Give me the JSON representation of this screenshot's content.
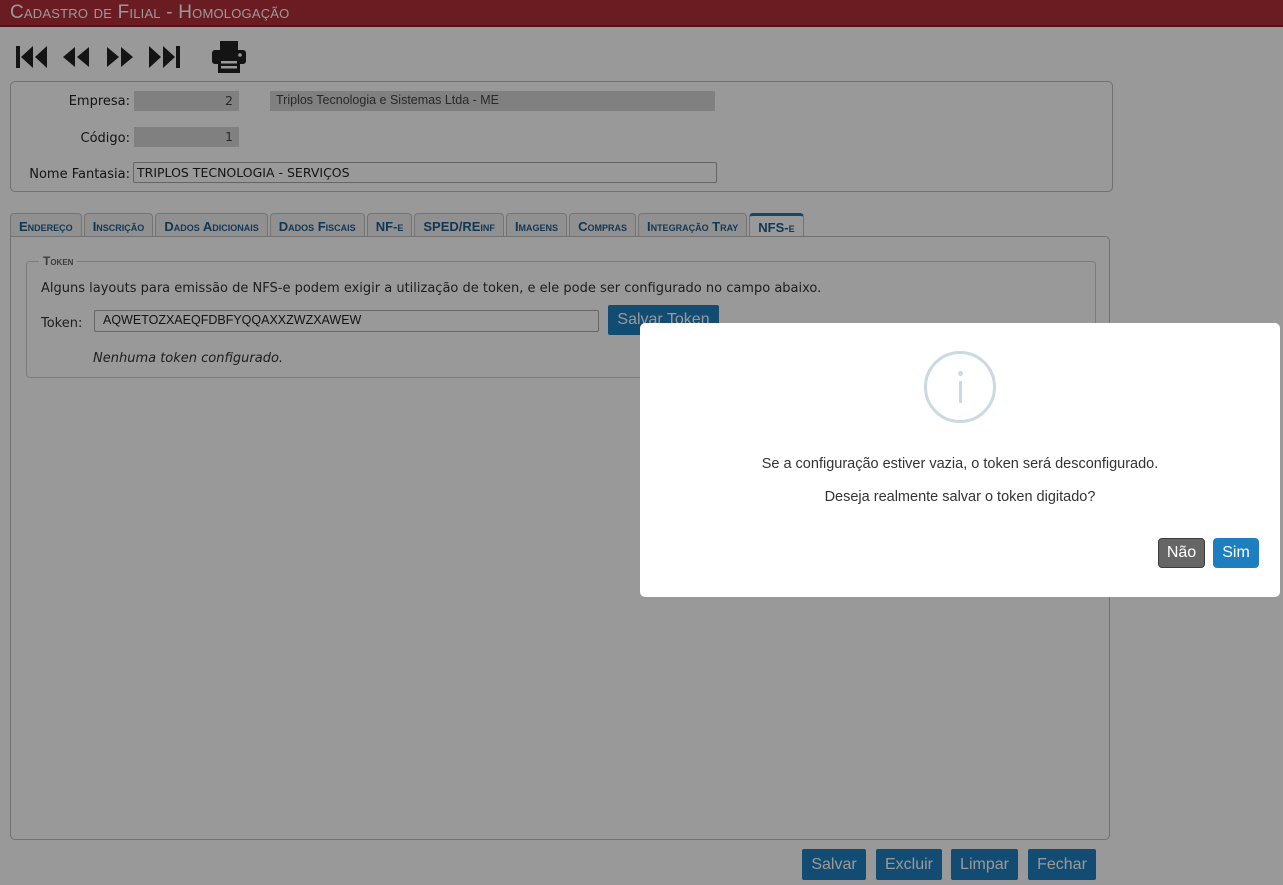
{
  "window": {
    "title": "Cadastro de Filial  - Homologação"
  },
  "toolbar": {
    "icons": [
      "first-record-icon",
      "previous-record-icon",
      "next-record-icon",
      "last-record-icon",
      "printer-icon"
    ]
  },
  "header": {
    "empresa_label": "Empresa:",
    "empresa_code": "2",
    "empresa_name": "Triplos Tecnologia e Sistemas Ltda - ME",
    "codigo_label": "Código:",
    "codigo_value": "1",
    "nome_fantasia_label": "Nome Fantasia:",
    "nome_fantasia_value": "TRIPLOS TECNOLOGIA - SERVIÇOS"
  },
  "tabs": [
    {
      "label": "Endereço"
    },
    {
      "label": "Inscrição"
    },
    {
      "label": "Dados Adicionais"
    },
    {
      "label": "Dados Fiscais"
    },
    {
      "label": "NF-e"
    },
    {
      "label": "SPED/REinf"
    },
    {
      "label": "Imagens"
    },
    {
      "label": "Compras"
    },
    {
      "label": "Integração Tray"
    },
    {
      "label": "NFS-e",
      "active": true
    }
  ],
  "token_section": {
    "legend": "Token",
    "help_text": "Alguns layouts para emissão de NFS-e podem exigir a utilização de token, e ele pode ser configurado no campo abaixo.",
    "token_label": "Token:",
    "token_value": "AQWETOZXAEQFDBFYQQAXXZWZXAWEW",
    "save_button": "Salvar Token",
    "status": "Nenhuma token configurado."
  },
  "footer": {
    "save": "Salvar",
    "delete": "Excluir",
    "clear": "Limpar",
    "close": "Fechar"
  },
  "dialog": {
    "icon": "info-icon",
    "message_1": "Se a configuração estiver vazia, o token será desconfigurado.",
    "message_2": "Deseja realmente salvar o token digitado?",
    "no_button": "Não",
    "yes_button": "Sim"
  },
  "colors": {
    "title_bar": "#b32d39",
    "accent_blue": "#1e7fc0",
    "tab_text": "#1d5d8f",
    "no_button": "#666666",
    "overlay": "rgba(0,0,0,0.4)"
  }
}
